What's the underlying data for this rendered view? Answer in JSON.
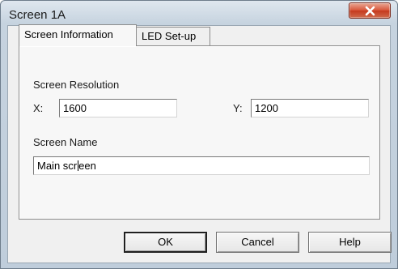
{
  "window": {
    "title": "Screen 1A",
    "close_icon": "close-icon"
  },
  "tabs": [
    {
      "label": "Screen Information",
      "selected": true
    },
    {
      "label": "LED Set-up",
      "selected": false
    }
  ],
  "screen_information": {
    "resolution_heading": "Screen Resolution",
    "x_label": "X:",
    "x_value": "1600",
    "y_label": "Y:",
    "y_value": "1200",
    "name_heading": "Screen Name",
    "name_value_before_caret": "Main scr",
    "name_value_after_caret": "een"
  },
  "buttons": {
    "ok": "OK",
    "cancel": "Cancel",
    "help": "Help"
  },
  "colors": {
    "close_button": "#c5391d",
    "frame": "#bfcddb"
  }
}
